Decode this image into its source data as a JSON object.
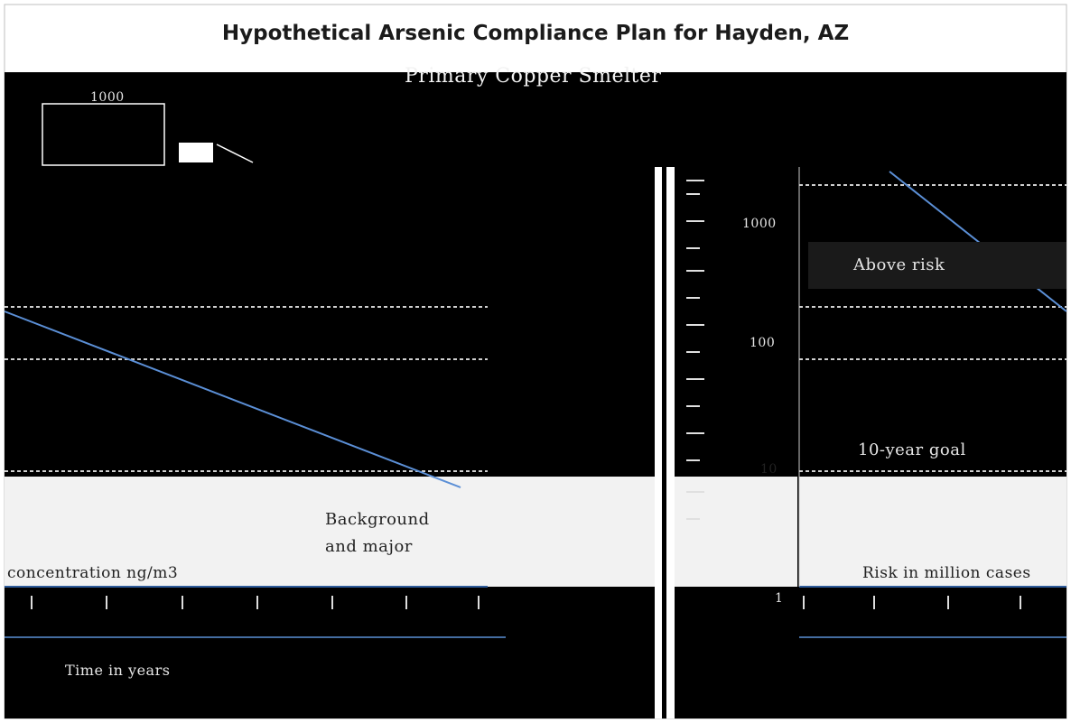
{
  "title": "Hypothetical Arsenic Compliance Plan for Hayden, AZ",
  "subtitle": "Primary Copper Smelter",
  "colors": {
    "background": "#000000",
    "band_light": "#f2f2f2",
    "trend_line": "#5b8fd6",
    "axis_line": "#2e5b9a",
    "frame": "#ffffff"
  },
  "labels": {
    "left_annotation_1": "Background",
    "left_annotation_2": "and major",
    "left_axis_label": "concentration ng/m3",
    "left_time_label": "Time in years",
    "right_label_1": "Above risk",
    "right_label_2": "10-year goal",
    "right_label_3": "Risk in million cases"
  },
  "chart_data": [
    {
      "type": "line",
      "title": "",
      "series": [
        {
          "name": "",
          "values": [
            1,
            0.35
          ]
        }
      ],
      "ylabel": "concentration ng/m3",
      "xlabel": "Time in years",
      "y_ticks": [
        "1000"
      ],
      "grid": false
    },
    {
      "type": "line",
      "title": "",
      "series": [
        {
          "name": "",
          "values": [
            1,
            0.04
          ]
        }
      ],
      "y_ticks": [
        "1000",
        "100",
        "10",
        "1"
      ],
      "grid": false
    }
  ]
}
